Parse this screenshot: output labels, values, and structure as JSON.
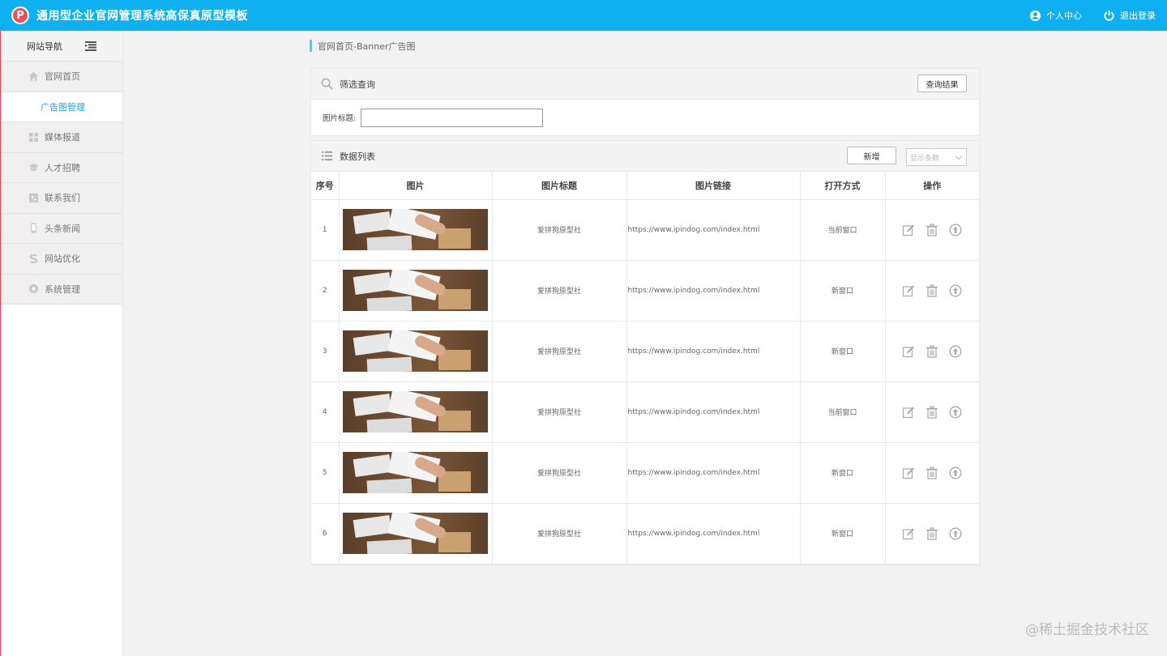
{
  "header": {
    "logo_letter": "P",
    "title": "通用型企业官网管理系统高保真原型模板",
    "user_center": "个人中心",
    "logout": "退出登录"
  },
  "sidebar": {
    "title": "网站导航",
    "items": [
      {
        "label": "官网首页",
        "icon": "home-icon"
      },
      {
        "label": "广告图管理",
        "icon": "",
        "active": true
      },
      {
        "label": "媒体报道",
        "icon": "grid-icon"
      },
      {
        "label": "人才招聘",
        "icon": "graduation-cap-icon"
      },
      {
        "label": "联系我们",
        "icon": "phone-icon"
      },
      {
        "label": "头条新闻",
        "icon": "mobile-icon"
      },
      {
        "label": "网站优化",
        "icon": "s-icon"
      },
      {
        "label": "系统管理",
        "icon": "gear-icon"
      }
    ]
  },
  "breadcrumb": "官网首页-Banner广告图",
  "filter": {
    "title": "筛选查询",
    "query_button": "查询结果",
    "field_label": "图片标题:",
    "field_value": ""
  },
  "list": {
    "title": "数据列表",
    "add_button": "新增",
    "page_size_placeholder": "显示条数",
    "columns": [
      "序号",
      "图片",
      "图片标题",
      "图片链接",
      "打开方式",
      "操作"
    ],
    "rows": [
      {
        "no": "1",
        "title": "爱拼狗原型社",
        "link": "https://www.ipindog.com/index.html",
        "open_mode": "当前窗口"
      },
      {
        "no": "2",
        "title": "爱拼狗原型社",
        "link": "https://www.ipindog.com/index.html",
        "open_mode": "新窗口"
      },
      {
        "no": "3",
        "title": "爱拼狗原型社",
        "link": "https://www.ipindog.com/index.html",
        "open_mode": "新窗口"
      },
      {
        "no": "4",
        "title": "爱拼狗原型社",
        "link": "https://www.ipindog.com/index.html",
        "open_mode": "当前窗口"
      },
      {
        "no": "5",
        "title": "爱拼狗原型社",
        "link": "https://www.ipindog.com/index.html",
        "open_mode": "新窗口"
      },
      {
        "no": "6",
        "title": "爱拼狗原型社",
        "link": "https://www.ipindog.com/index.html",
        "open_mode": "新窗口"
      }
    ]
  },
  "watermark": "@稀土掘金技术社区",
  "colors": {
    "topbar": "#0fb0f0",
    "active_nav": "#12a8e8",
    "logo": "#e9505a"
  }
}
